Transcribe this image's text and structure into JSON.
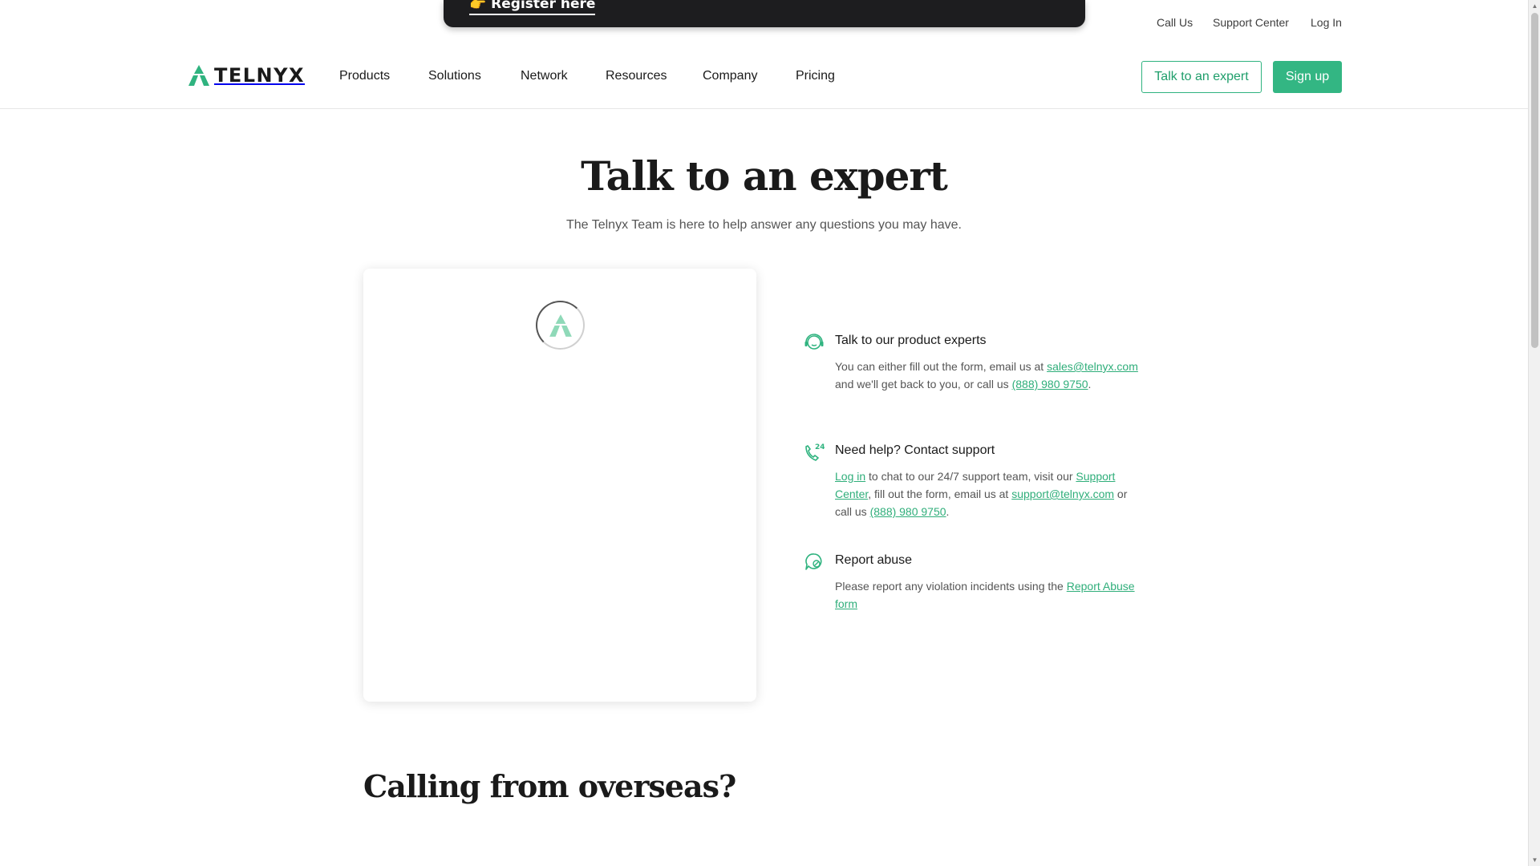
{
  "promo": {
    "label": "Register here",
    "hand": "👉"
  },
  "utility_nav": {
    "call_us": "Call Us",
    "support_center": "Support Center",
    "log_in": "Log In"
  },
  "logo": {
    "text": "TELNYX",
    "icon": "telnyx-triangle-icon",
    "color": "#2fb37f"
  },
  "nav": {
    "items": [
      {
        "label": "Products"
      },
      {
        "label": "Solutions"
      },
      {
        "label": "Network"
      },
      {
        "label": "Resources"
      },
      {
        "label": "Company"
      },
      {
        "label": "Pricing"
      }
    ],
    "talk_button": "Talk to an expert",
    "signup_button": "Sign up"
  },
  "hero": {
    "title": "Talk to an expert",
    "subtitle": "The Telnyx Team is here to help answer any questions you may have."
  },
  "form_card": {
    "loader_icon": "loading-spinner-icon"
  },
  "contact": {
    "experts": {
      "icon": "headset-icon",
      "title": "Talk to our product experts",
      "text1": "You can either fill out the form, email us at ",
      "email": "sales@telnyx.com",
      "text2": " and we'll get back to you, or call us ",
      "phone": "(888) 980 9750",
      "text3": "."
    },
    "support": {
      "icon": "phone-24-icon",
      "title": "Need help? Contact support",
      "login_link": "Log in",
      "text1": " to chat to our 24/7 support team, visit our ",
      "support_link": "Support Center",
      "text2": ", fill out the form, email us at ",
      "email": "support@telnyx.com",
      "text3": " or call us ",
      "phone": "(888) 980 9750",
      "text4": "."
    },
    "abuse": {
      "icon": "report-chat-icon",
      "title": "Report abuse",
      "text1": "Please report any violation incidents using the ",
      "link": "Report Abuse form"
    }
  },
  "overseas": {
    "title": "Calling from overseas?"
  },
  "colors": {
    "accent": "#33b683",
    "link": "#2fae7a",
    "banner_bg": "#1d1d1f"
  }
}
